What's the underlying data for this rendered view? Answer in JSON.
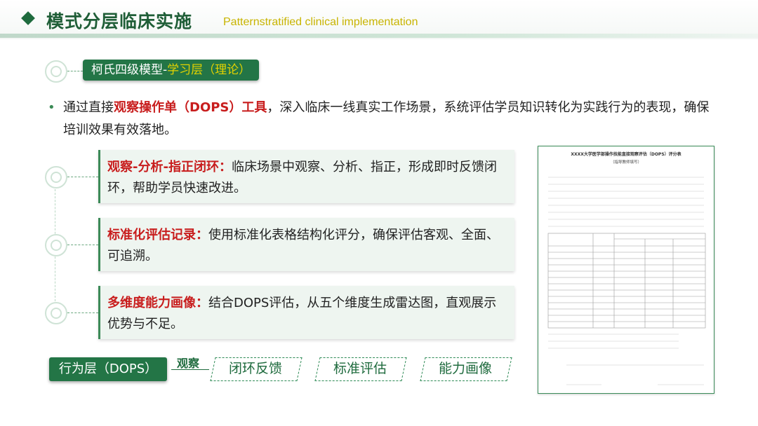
{
  "header": {
    "title": "模式分层临床实施",
    "subtitle": "Patternstratified clinical implementation"
  },
  "layer_pill": {
    "prefix": "柯氏四级模型-",
    "highlight": "学习层（理论）"
  },
  "bullet": {
    "dot": "•",
    "before": "通过直接",
    "highlight": "观察操作单（DOPS）工具",
    "after": "，深入临床一线真实工作场景，系统评估学员知识转化为实践行为的表现，确保培训效果有效落地。"
  },
  "cards": [
    {
      "label": "观察-分析-指正闭环：",
      "text": "临床场景中观察、分析、指正，形成即时反馈闭环，帮助学员快速改进。"
    },
    {
      "label": "标准化评估记录：",
      "text": "使用标准化表格结构化评分，确保评估客观、全面、可追溯。"
    },
    {
      "label": "多维度能力画像：",
      "text": "结合DOPS评估，从五个维度生成雷达图，直观展示优势与不足。"
    }
  ],
  "behavior": {
    "label": "行为层（DOPS）",
    "observe": "观察",
    "outcomes": [
      "闭环反馈",
      "标准评估",
      "能力画像"
    ]
  },
  "form": {
    "title": "XXXX大学医学部操作技能直接观察评估（DOPS）评分表",
    "subtitle": "（指导教师填写）"
  },
  "colors": {
    "brand": "#237546",
    "accent": "#e2d200",
    "highlight": "#c81d1d"
  }
}
